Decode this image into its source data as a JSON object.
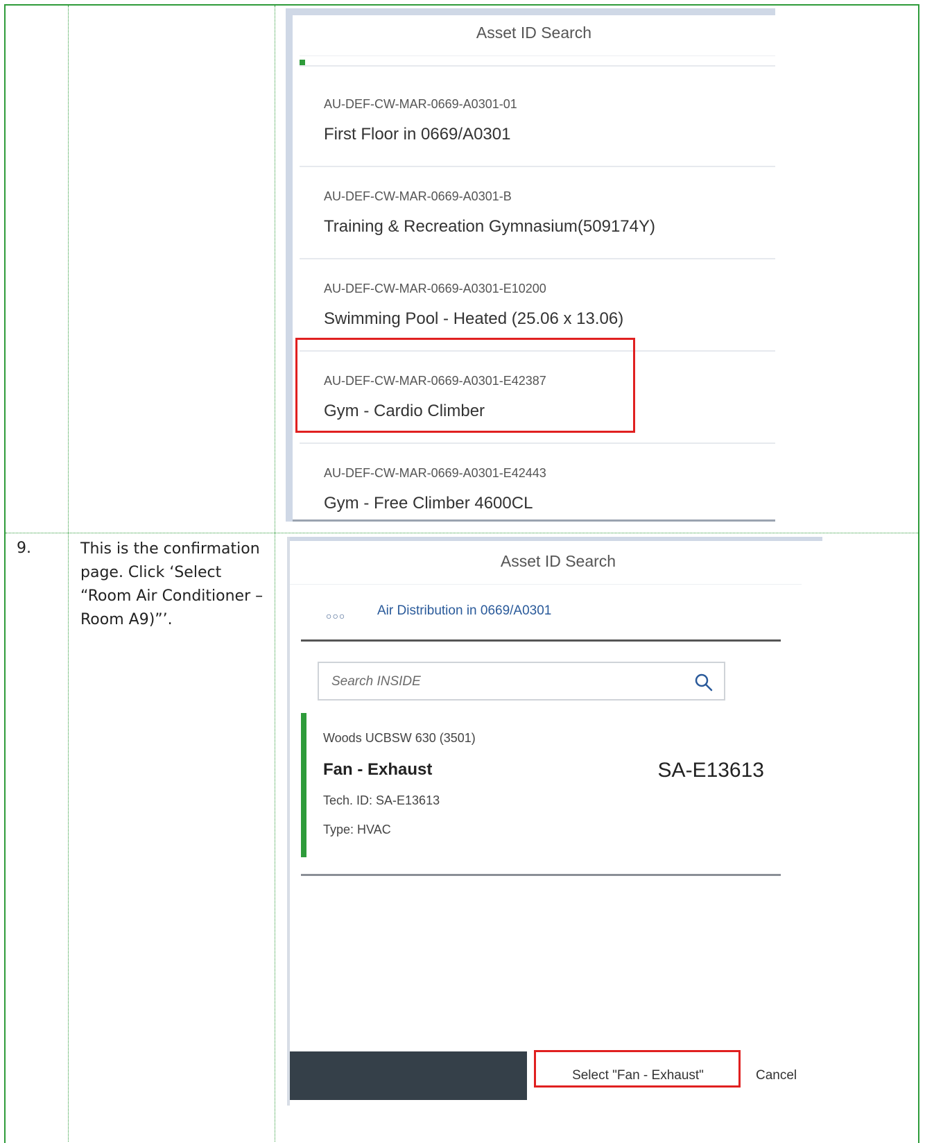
{
  "step": {
    "number": "9.",
    "description": "This is the confirmation page. Click ‘Select “Room Air Conditioner – Room A9)”’."
  },
  "screen1": {
    "title": "Asset ID Search",
    "items": [
      {
        "id": "AU-DEF-CW-MAR-0669-A0301-01",
        "name": "First Floor in 0669/A0301"
      },
      {
        "id": "AU-DEF-CW-MAR-0669-A0301-B",
        "name": "Training & Recreation Gymnasium(509174Y)"
      },
      {
        "id": "AU-DEF-CW-MAR-0669-A0301-E10200",
        "name": "Swimming Pool - Heated (25.06 x 13.06)"
      },
      {
        "id": "AU-DEF-CW-MAR-0669-A0301-E42387",
        "name": "Gym - Cardio Climber"
      },
      {
        "id": "AU-DEF-CW-MAR-0669-A0301-E42443",
        "name": "Gym - Free Climber 4600CL"
      }
    ]
  },
  "screen2": {
    "title": "Asset ID Search",
    "breadcrumb": "Air Distribution in 0669/A0301",
    "search": {
      "placeholder": "Search INSIDE",
      "value": ""
    },
    "item": {
      "subtitle": "Woods UCBSW 630 (3501)",
      "name": "Fan - Exhaust",
      "code": "SA-E13613",
      "tech_id": "Tech. ID: SA-E13613",
      "type": "Type: HVAC"
    },
    "footer": {
      "select_label": "Select \"Fan - Exhaust\"",
      "cancel_label": "Cancel"
    }
  },
  "colors": {
    "table_border": "#2e9b3a",
    "accent": "#2e9b3a",
    "highlight": "#e02020",
    "footer": "#354049",
    "link": "#2a5a9a"
  },
  "icons": [
    "more-dots-icon",
    "search-icon"
  ]
}
